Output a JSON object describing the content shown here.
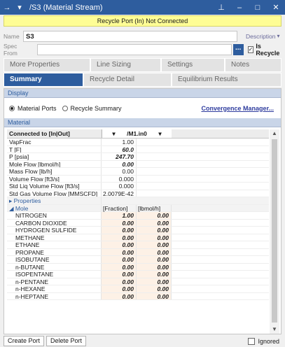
{
  "window": {
    "title": "/S3 (Material Stream)",
    "pin_icon": "pin-icon",
    "minimize_icon": "minimize-icon",
    "maximize_icon": "maximize-icon",
    "close_icon": "close-icon"
  },
  "warning": "Recycle Port (In) Not Connected",
  "name_row": {
    "label": "Name",
    "value": "S3",
    "description_link": "Description"
  },
  "spec_row": {
    "label": "Spec From",
    "value": "",
    "browse_label": "...",
    "is_recycle_label": "Is Recycle",
    "is_recycle_checked": true
  },
  "tabs_row1": [
    "More Properties",
    "Line Sizing",
    "Settings",
    "Notes"
  ],
  "tabs_row2": [
    "Summary",
    "Recycle Detail",
    "Equilibrium Results"
  ],
  "active_tab": "Summary",
  "display": {
    "header": "Display",
    "options": [
      "Material Ports",
      "Recycle Summary"
    ],
    "selected": "Material Ports",
    "convergence_link": "Convergence Manager..."
  },
  "material": {
    "header": "Material",
    "connected_label": "Connected to [In|Out]",
    "stream_col": "/M1.in0",
    "rows": [
      {
        "label": "VapFrac",
        "value": "1.00",
        "style": "normal"
      },
      {
        "label": "T [F]",
        "value": "60.0",
        "style": "italic-bold"
      },
      {
        "label": "P [psia]",
        "value": "247.70",
        "style": "italic-bold"
      },
      {
        "label": "Mole Flow [lbmol/h]",
        "value": "0.00",
        "style": "italic-bold"
      },
      {
        "label": "Mass Flow [lb/h]",
        "value": "0.00",
        "style": "normal"
      },
      {
        "label": "Volume Flow [ft3/s]",
        "value": "0.000",
        "style": "normal"
      },
      {
        "label": "Std Liq Volume Flow [ft3/s]",
        "value": "0.000",
        "style": "normal"
      },
      {
        "label": "Std Gas Volume Flow [MMSCFD]",
        "value": "2.0079E-42",
        "style": "normal"
      }
    ],
    "properties_label": "Properties",
    "mole_label": "Mole",
    "mole_col1": "[Fraction]",
    "mole_col2": "[lbmol/h]",
    "components": [
      {
        "name": "NITROGEN",
        "fraction": "1.00",
        "flow": "0.00"
      },
      {
        "name": "CARBON DIOXIDE",
        "fraction": "0.00",
        "flow": "0.00"
      },
      {
        "name": "HYDROGEN SULFIDE",
        "fraction": "0.00",
        "flow": "0.00"
      },
      {
        "name": "METHANE",
        "fraction": "0.00",
        "flow": "0.00"
      },
      {
        "name": "ETHANE",
        "fraction": "0.00",
        "flow": "0.00"
      },
      {
        "name": "PROPANE",
        "fraction": "0.00",
        "flow": "0.00"
      },
      {
        "name": "ISOBUTANE",
        "fraction": "0.00",
        "flow": "0.00"
      },
      {
        "name": "n-BUTANE",
        "fraction": "0.00",
        "flow": "0.00"
      },
      {
        "name": "ISOPENTANE",
        "fraction": "0.00",
        "flow": "0.00"
      },
      {
        "name": "n-PENTANE",
        "fraction": "0.00",
        "flow": "0.00"
      },
      {
        "name": "n-HEXANE",
        "fraction": "0.00",
        "flow": "0.00"
      },
      {
        "name": "n-HEPTANE",
        "fraction": "0.00",
        "flow": "0.00"
      }
    ]
  },
  "bottom": {
    "create_port": "Create Port",
    "delete_port": "Delete Port",
    "ignored_label": "Ignored"
  },
  "colors": {
    "accent": "#2e5d9e",
    "warning_bg": "#fefd95",
    "section_bg": "#c9d5e8"
  }
}
